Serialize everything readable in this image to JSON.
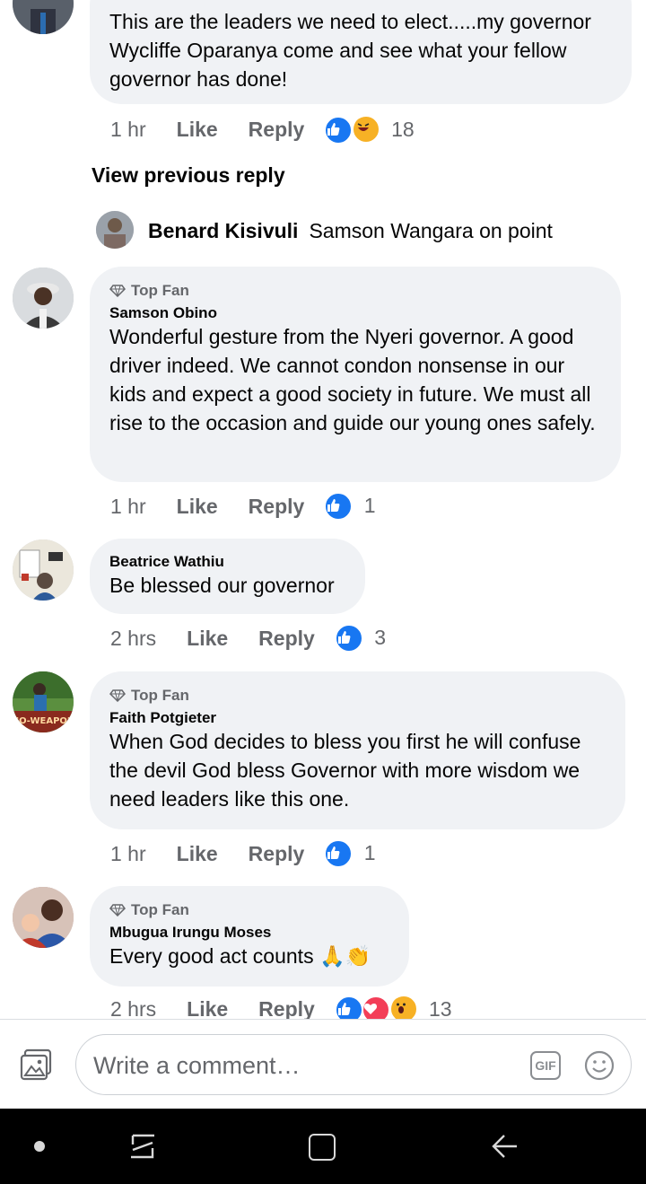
{
  "comments": [
    {
      "text": "This are the leaders we need to elect.....my governor Wycliffe Oparanya come and see what your fellow governor has done!",
      "time": "1 hr",
      "like": "Like",
      "reply": "Reply",
      "count": "18"
    },
    {
      "view_previous": "View previous reply",
      "reply_name": "Benard Kisivuli",
      "reply_text": "Samson Wangara on point"
    },
    {
      "badge": "Top Fan",
      "name": "Samson Obino",
      "text": "Wonderful gesture from the Nyeri governor. A good driver indeed. We cannot condon nonsense in our kids and expect a good society in future. We must all rise to the occasion and guide our young ones safely.",
      "time": "1 hr",
      "like": "Like",
      "reply": "Reply",
      "count": "1"
    },
    {
      "name": "Beatrice Wathiu",
      "text": "Be blessed our governor",
      "time": "2 hrs",
      "like": "Like",
      "reply": "Reply",
      "count": "3"
    },
    {
      "badge": "Top Fan",
      "name": "Faith Potgieter",
      "text": "When God decides to bless you first he will confuse the devil God bless Governor with more wisdom we need leaders like this one.",
      "time": "1 hr",
      "like": "Like",
      "reply": "Reply",
      "count": "1",
      "avatar_text": "NO-WEAPON"
    },
    {
      "badge": "Top Fan",
      "name": "Mbugua Irungu Moses",
      "text": "Every good act counts 🙏👏",
      "time": "2 hrs",
      "like": "Like",
      "reply": "Reply",
      "count": "13"
    }
  ],
  "composer": {
    "placeholder": "Write a comment…",
    "gif": "GIF"
  },
  "colors": {
    "like_blue": "#1877f2",
    "love_red": "#f33e58",
    "haha_yellow": "#f7b125",
    "bubble": "#f0f2f5",
    "meta_gray": "#65676b"
  },
  "icons": [
    "like-reaction-icon",
    "haha-reaction-icon",
    "love-reaction-icon",
    "wow-reaction-icon",
    "top-fan-diamond-icon",
    "photo-icon",
    "gif-icon",
    "emoji-icon",
    "recents-nav-icon",
    "home-nav-icon",
    "back-nav-icon"
  ]
}
